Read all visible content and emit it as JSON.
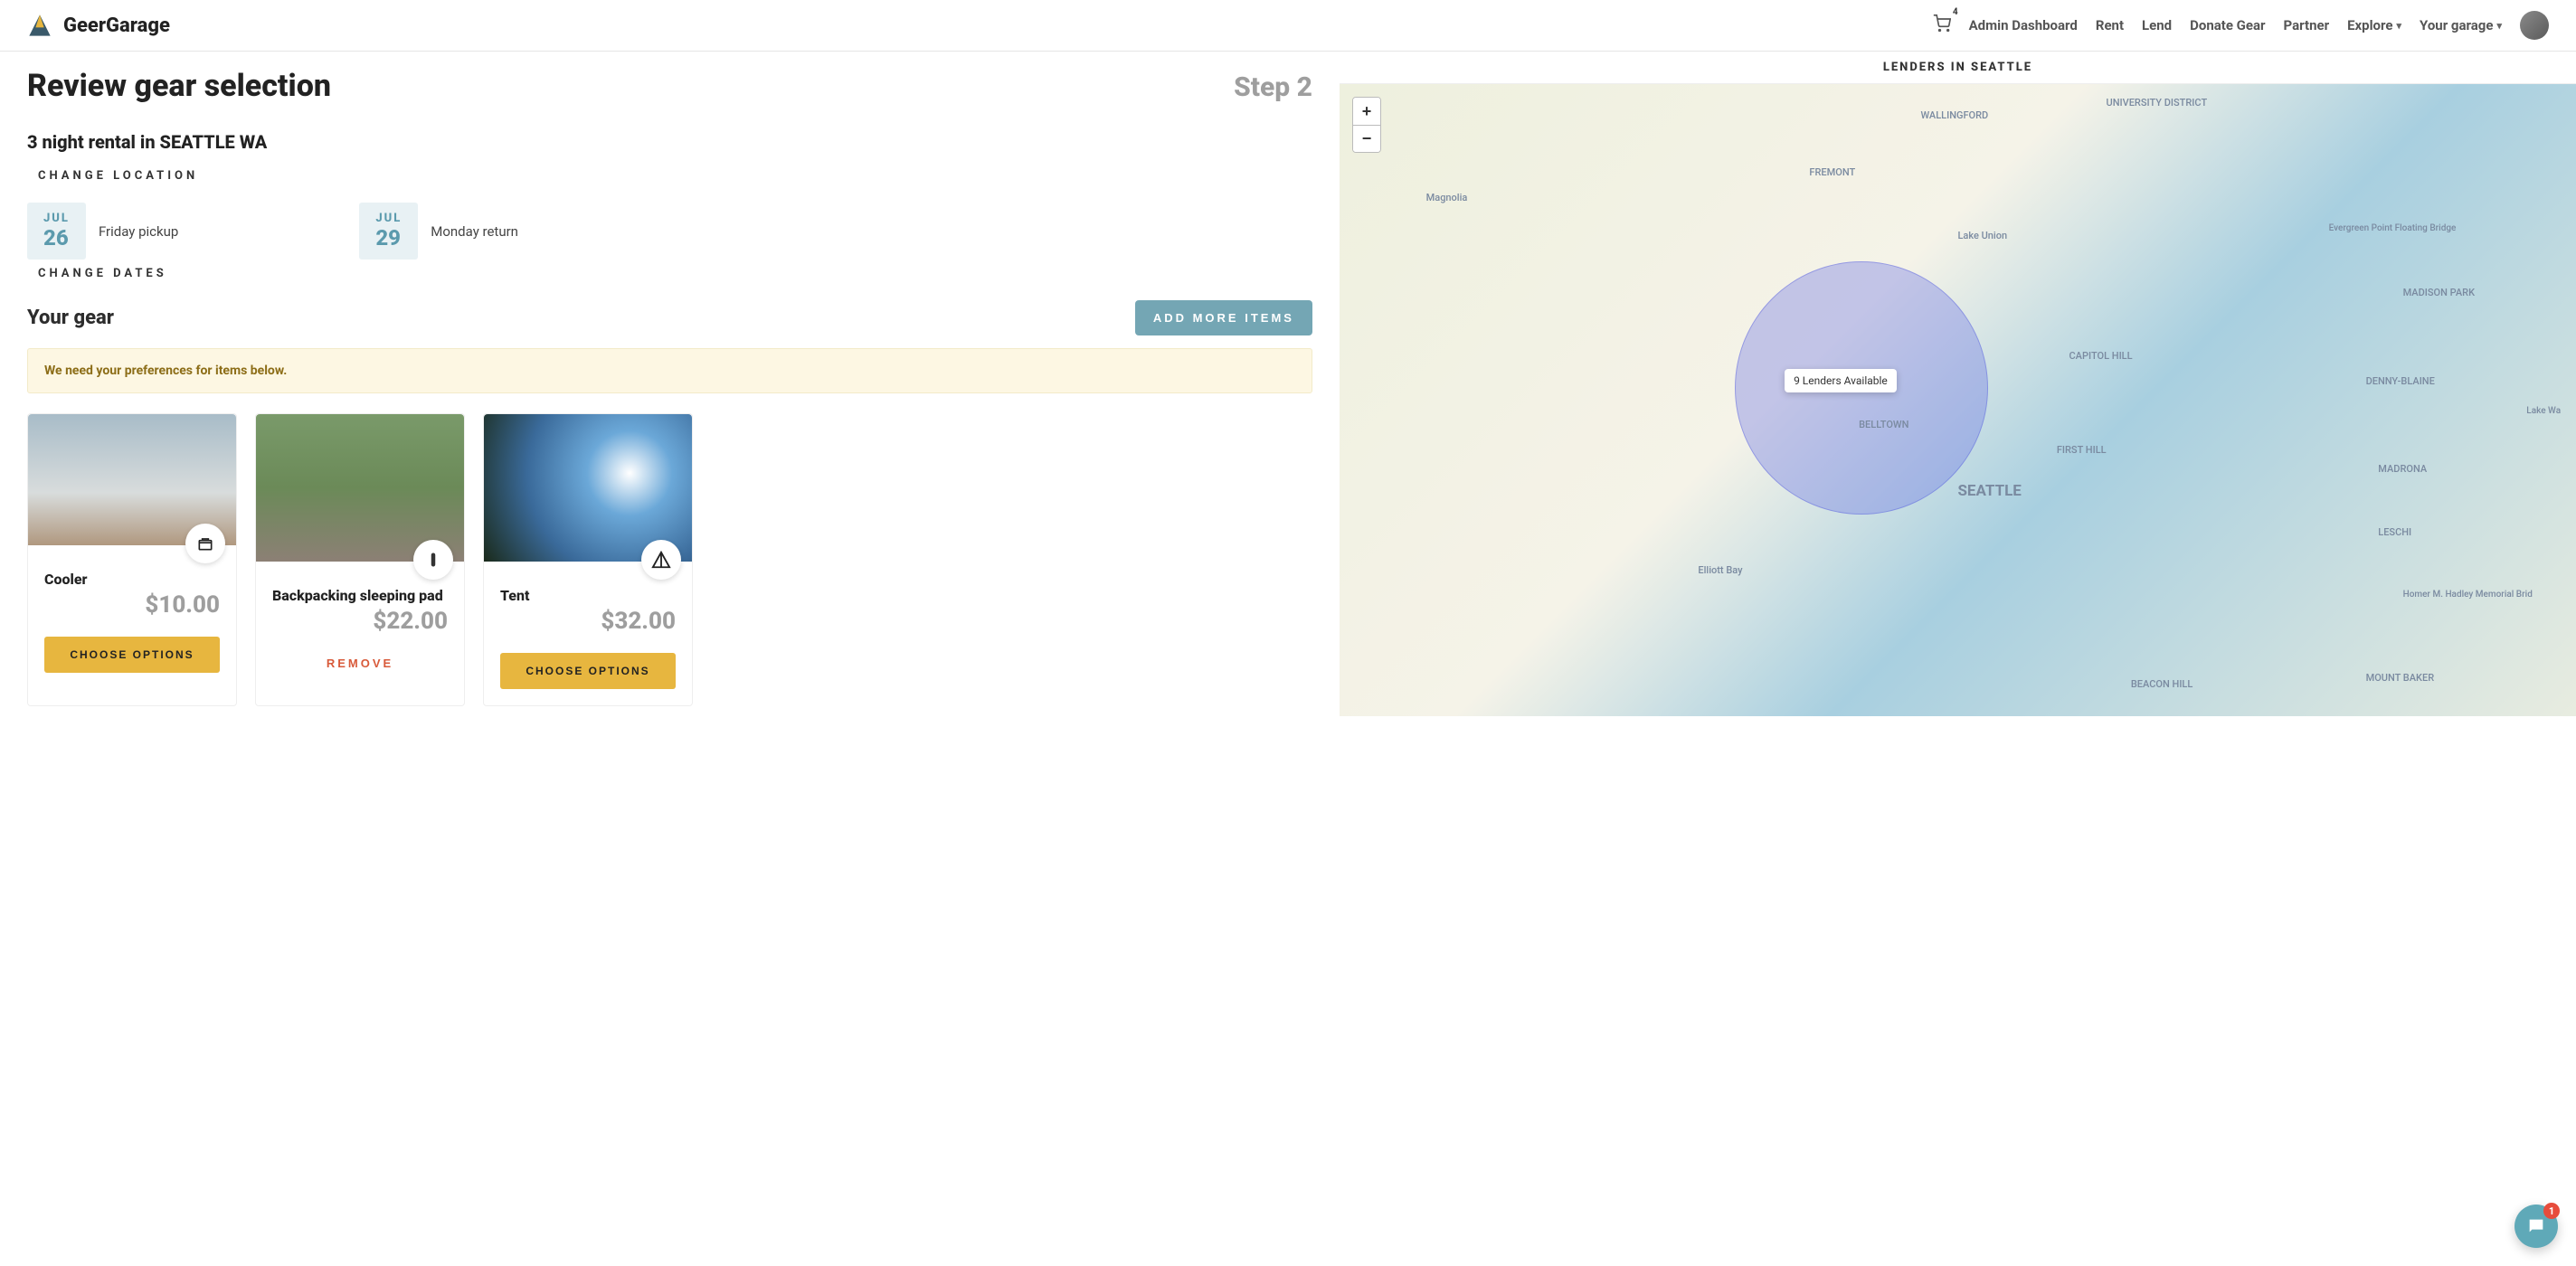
{
  "brand": "GeerGarage",
  "nav": {
    "cart_count": "4",
    "items": [
      "Admin Dashboard",
      "Rent",
      "Lend",
      "Donate Gear",
      "Partner",
      "Explore",
      "Your garage"
    ]
  },
  "page": {
    "title": "Review gear selection",
    "step": "Step 2",
    "subtitle": "3 night rental in SEATTLE WA",
    "change_location": "CHANGE LOCATION",
    "change_dates": "CHANGE DATES"
  },
  "pickup": {
    "month": "JUL",
    "day": "26",
    "desc": "Friday pickup"
  },
  "return": {
    "month": "JUL",
    "day": "29",
    "desc": "Monday return"
  },
  "gear": {
    "heading": "Your gear",
    "add_more": "ADD MORE ITEMS",
    "notice": "We need your preferences for items below.",
    "choose_label": "CHOOSE OPTIONS",
    "remove_label": "REMOVE",
    "items": [
      {
        "name": "Cooler",
        "price": "$10.00",
        "action": "choose"
      },
      {
        "name": "Backpacking sleeping pad",
        "price": "$22.00",
        "action": "remove"
      },
      {
        "name": "Tent",
        "price": "$32.00",
        "action": "choose"
      }
    ]
  },
  "map": {
    "title": "LENDERS IN SEATTLE",
    "popup": "9 Lenders Available",
    "city": "SEATTLE",
    "labels": {
      "university": "UNIVERSITY DISTRICT",
      "wallingford": "WALLINGFORD",
      "fremont": "FREMONT",
      "magnolia": "Magnolia",
      "lakeunion": "Lake Union",
      "capitolhill": "CAPITOL HILL",
      "belltown": "BELLTOWN",
      "firsthill": "FIRST HILL",
      "madisonpark": "MADISON PARK",
      "dennyblaine": "DENNY-BLAINE",
      "madrona": "MADRONA",
      "leschi": "LESCHI",
      "elliott": "Elliott Bay",
      "beacon": "BEACON HILL",
      "baker": "MOUNT BAKER",
      "bridge": "Evergreen Point Floating Bridge",
      "hadley": "Homer M. Hadley Memorial Brid",
      "lakewa": "Lake Wa"
    }
  },
  "chat_count": "1"
}
